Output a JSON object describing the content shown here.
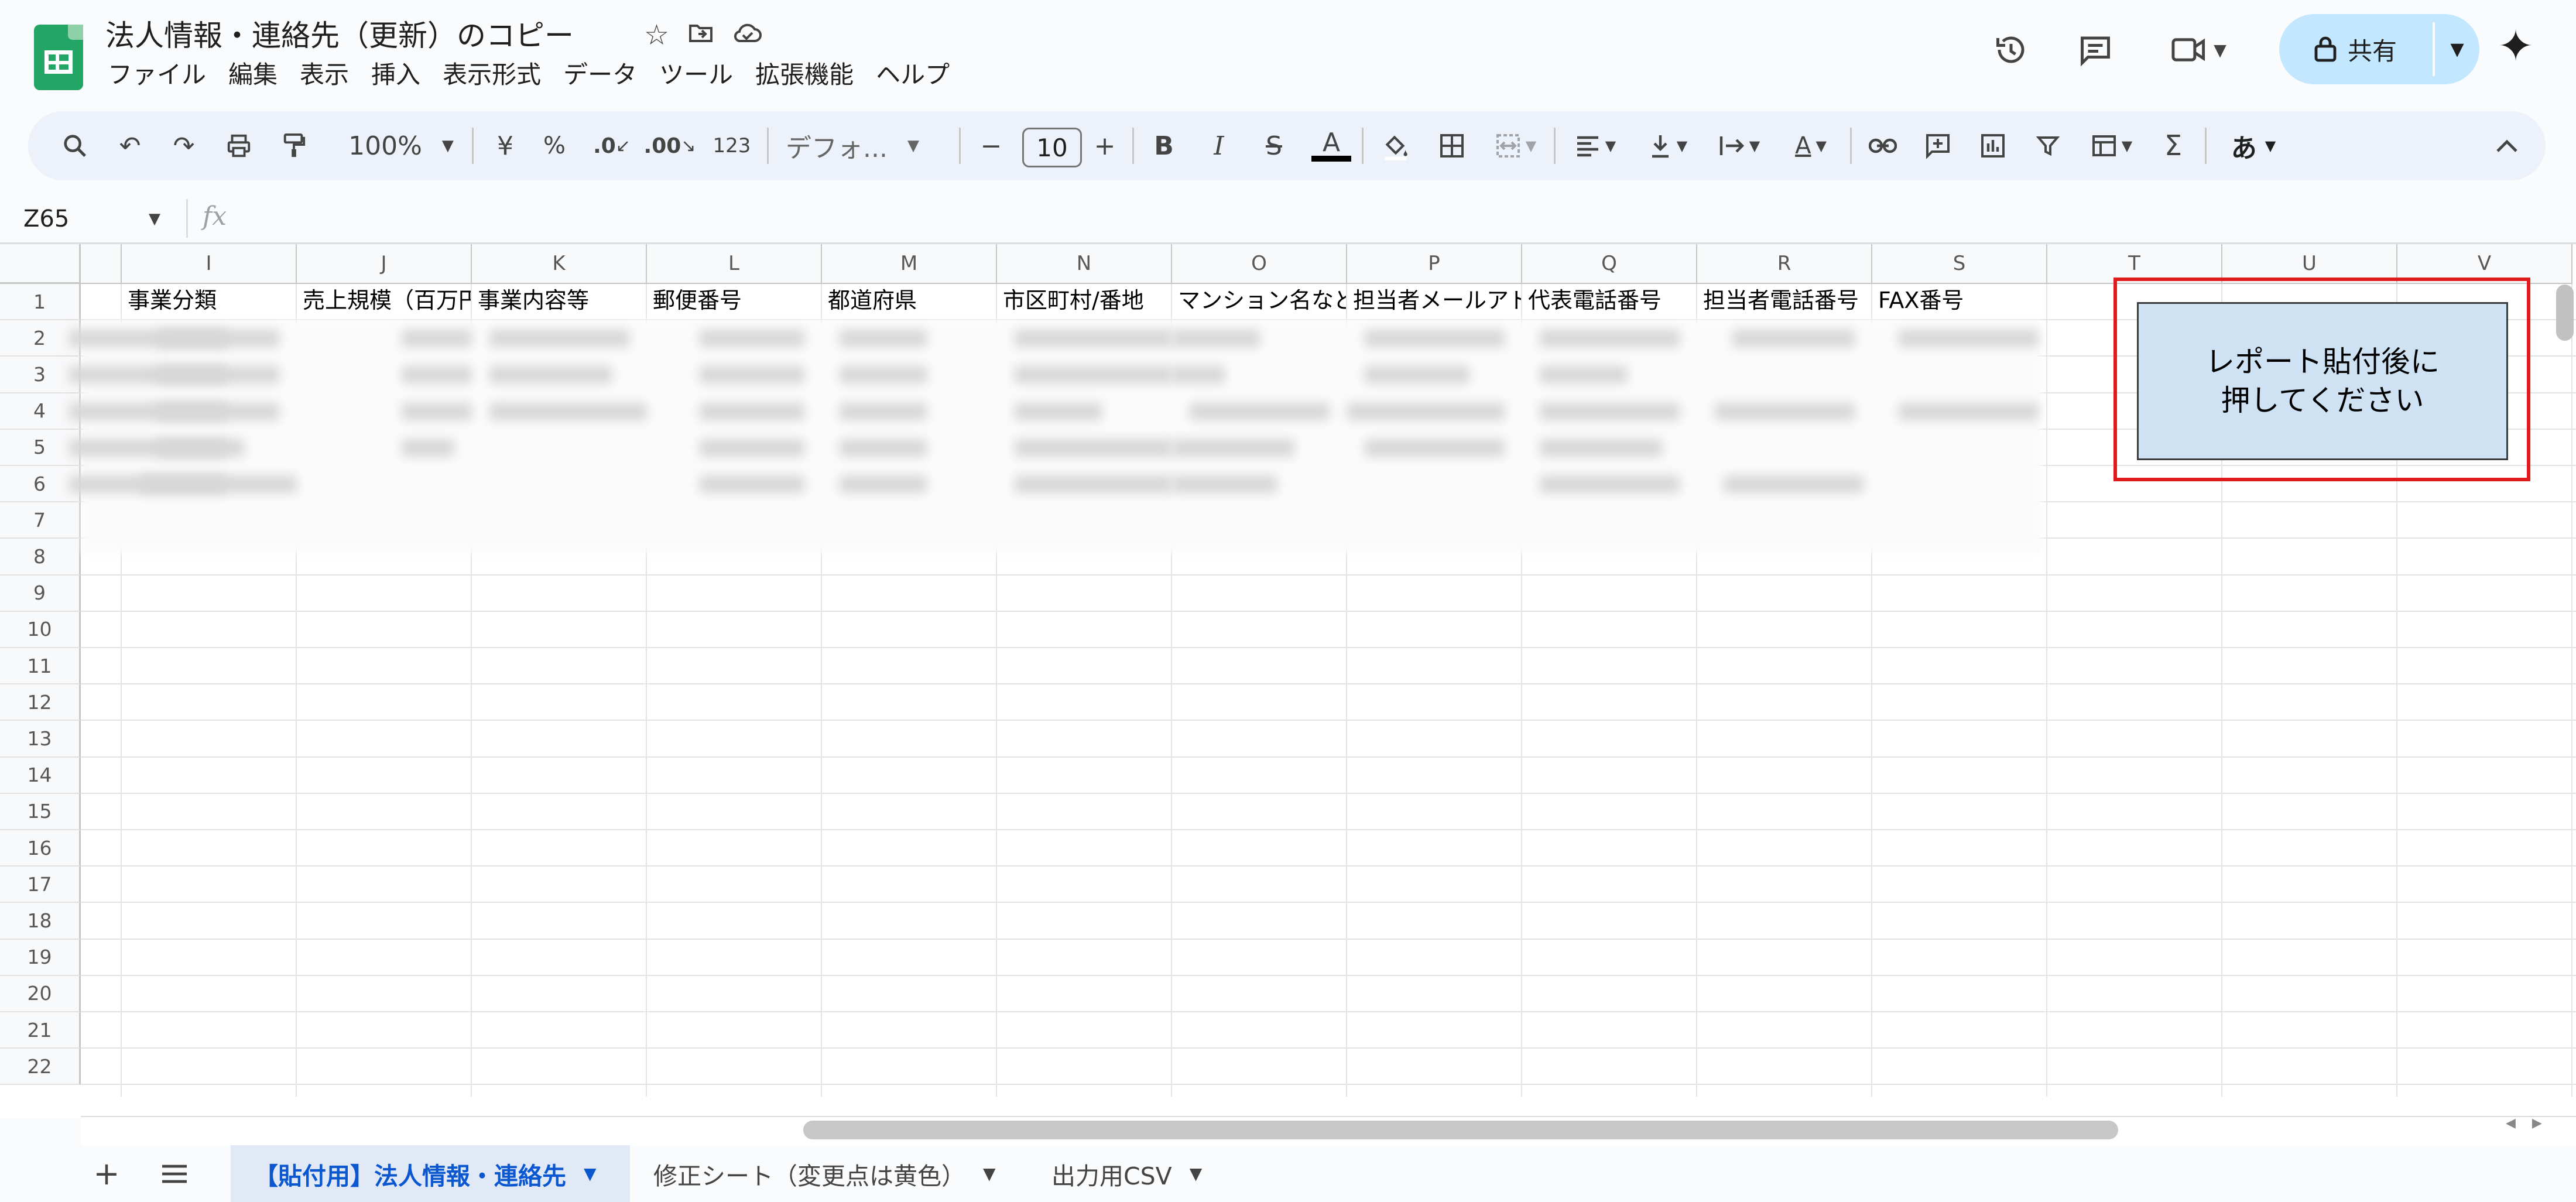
{
  "header": {
    "title": "法人情報・連絡先（更新）のコピー",
    "title_icons": [
      "star-icon",
      "move-to-folder-icon",
      "cloud-saved-icon"
    ],
    "menu": [
      "ファイル",
      "編集",
      "表示",
      "挿入",
      "表示形式",
      "データ",
      "ツール",
      "拡張機能",
      "ヘルプ"
    ],
    "right_icons": [
      "history-icon",
      "comments-icon",
      "meet-video-icon"
    ],
    "share_label": "共有",
    "gemini_icon": "sparkle-icon"
  },
  "toolbar": {
    "zoom": "100%",
    "currency": "¥",
    "percent": "%",
    "dec_decrease": ".0",
    "dec_increase": ".00",
    "number_format": "123",
    "font": "デフォ...",
    "font_size": "10",
    "minus": "−",
    "plus": "+",
    "bold": "B",
    "italic": "I",
    "strike": "S",
    "text_color": "A",
    "input_tools": "あ"
  },
  "formula_bar": {
    "name_box": "Z65",
    "fx": "fx"
  },
  "grid": {
    "columns": [
      "I",
      "J",
      "K",
      "L",
      "M",
      "N",
      "O",
      "P",
      "Q",
      "R",
      "S",
      "T",
      "U",
      "V"
    ],
    "rows": [
      "1",
      "2",
      "3",
      "4",
      "5",
      "6",
      "7",
      "8",
      "9",
      "10",
      "11",
      "12",
      "13",
      "14",
      "15",
      "16",
      "17",
      "18",
      "19",
      "20",
      "21",
      "22"
    ],
    "header_row": [
      "事業分類",
      "売上規模（百万円",
      "事業内容等",
      "郵便番号",
      "都道府県",
      "市区町村/番地",
      "マンション名など",
      "担当者メールアドレス",
      "代表電話番号",
      "担当者電話番号",
      "FAX番号"
    ]
  },
  "report_button": {
    "label": "レポート貼付後に\n押してください"
  },
  "tabs": {
    "add_icon": "plus-icon",
    "all_sheets_icon": "menu-icon",
    "sheets": [
      "【貼付用】法人情報・連絡先",
      "修正シート（変更点は黄色）",
      "出力用CSV"
    ],
    "active_index": 0
  },
  "colors": {
    "accent_blue": "#0b57d0",
    "share_bg": "#c2e7ff",
    "button_fill": "#cfe2f3",
    "highlight_red": "#e01b1b",
    "sheets_green": "#23a566"
  }
}
